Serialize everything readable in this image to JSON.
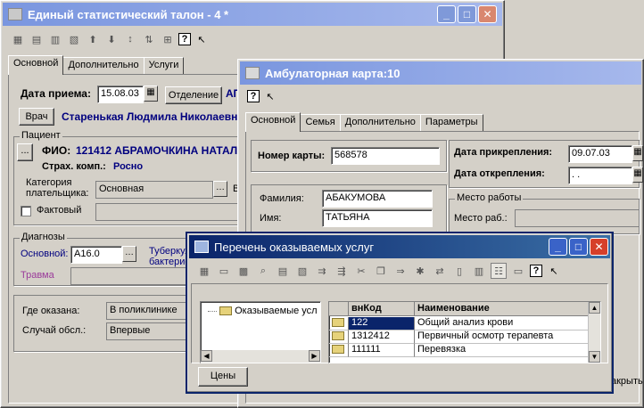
{
  "window1": {
    "title": "Единый статистический талон - 4 *",
    "tabs": [
      "Основной",
      "Дополнительно",
      "Услуги"
    ],
    "date_label": "Дата приема:",
    "date_value": "15.08.03",
    "department_button": "Отделение",
    "department_value": "АП",
    "doctor_button": "Врач",
    "doctor_value": "Старенькая Людмила Николаевн",
    "patient_group": "Пациент",
    "patient_button": "...",
    "fio_label": "ФИО:",
    "fio_value": "121412 АБРАМОЧКИНА НАТАЛ",
    "insurance_label": "Страх. комп.:",
    "insurance_value": "Росно",
    "payer_label_1": "Категория",
    "payer_label_2": "плательщика:",
    "payer_value": "Основная",
    "payer_extra": "В",
    "actual_label": "Фактовый",
    "diagnoses_group": "Диагнозы",
    "main_diag_label": "Основной:",
    "main_diag_value": "A16.0",
    "main_diag_desc_1": "Туберкуле",
    "main_diag_desc_2": "бактериол",
    "trauma_label": "Травма",
    "where_label": "Где оказана:",
    "where_value": "В поликлинике",
    "case_label": "Случай обсл.:",
    "case_value": "Впервые"
  },
  "window2": {
    "title": "Амбулаторная карта:10",
    "tabs": [
      "Основной",
      "Семья",
      "Дополнительно",
      "Параметры"
    ],
    "card_label": "Номер карты:",
    "card_value": "568578",
    "attach_label": "Дата прикрепления:",
    "attach_value": "09.07.03",
    "detach_label": "Дата открепления:",
    "detach_value": " .  .",
    "surname_label": "Фамилия:",
    "surname_value": "АБАКУМОВА",
    "name_label": "Имя:",
    "name_value": "ТАТЬЯНА",
    "workplace_group": "Место работы",
    "workplace_label": "Место раб.:",
    "bottom_right_text": "акрыть"
  },
  "window3": {
    "title": "Перечень оказываемых услуг",
    "tree_item": "Оказываемые усл",
    "grid_headers": [
      "внКод",
      "Наименование"
    ],
    "rows": [
      {
        "code": "122",
        "name": "Общий анализ крови"
      },
      {
        "code": "1312412",
        "name": "Первичный осмотр терапевта"
      },
      {
        "code": "111111",
        "name": "Перевязка"
      }
    ],
    "prices_button": "Цены"
  },
  "icons": {
    "help": "?",
    "whats_this": "?",
    "minimize": "_",
    "maximize": "□",
    "close": "✕"
  }
}
